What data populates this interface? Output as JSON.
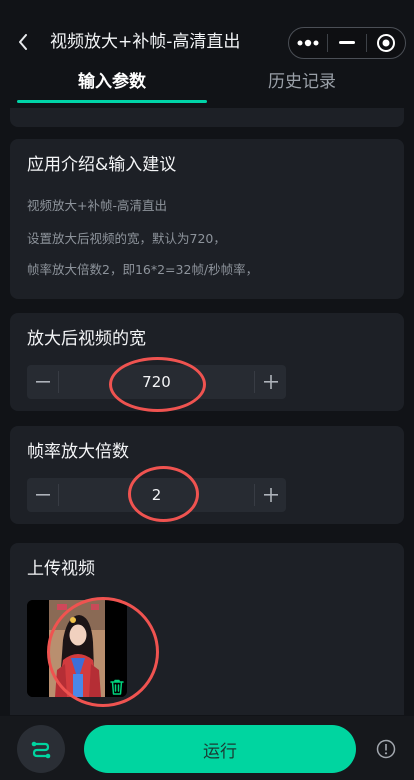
{
  "nav": {
    "title": "视频放大+补帧-高清直出",
    "icons": [
      "back-chevron-icon",
      "more-dots-icon",
      "minimize-icon",
      "close-target-icon"
    ]
  },
  "tabs": [
    {
      "label": "输入参数",
      "active": true
    },
    {
      "label": "历史记录",
      "active": false
    }
  ],
  "intro": {
    "heading": "应用介绍&输入建议",
    "lines": [
      "视频放大+补帧-高清直出",
      "设置放大后视频的宽，默认为720，",
      "帧率放大倍数2，即16*2=32帧/秒帧率，"
    ]
  },
  "width_field": {
    "label": "放大后视频的宽",
    "value": "720"
  },
  "fps_field": {
    "label": "帧率放大倍数",
    "value": "2"
  },
  "upload": {
    "heading": "上传视频"
  },
  "bottom": {
    "run_label": "运行"
  },
  "colors": {
    "accent": "#00d5a0",
    "annotation": "#ef5350",
    "card": "#1d2026",
    "background": "#111317"
  }
}
